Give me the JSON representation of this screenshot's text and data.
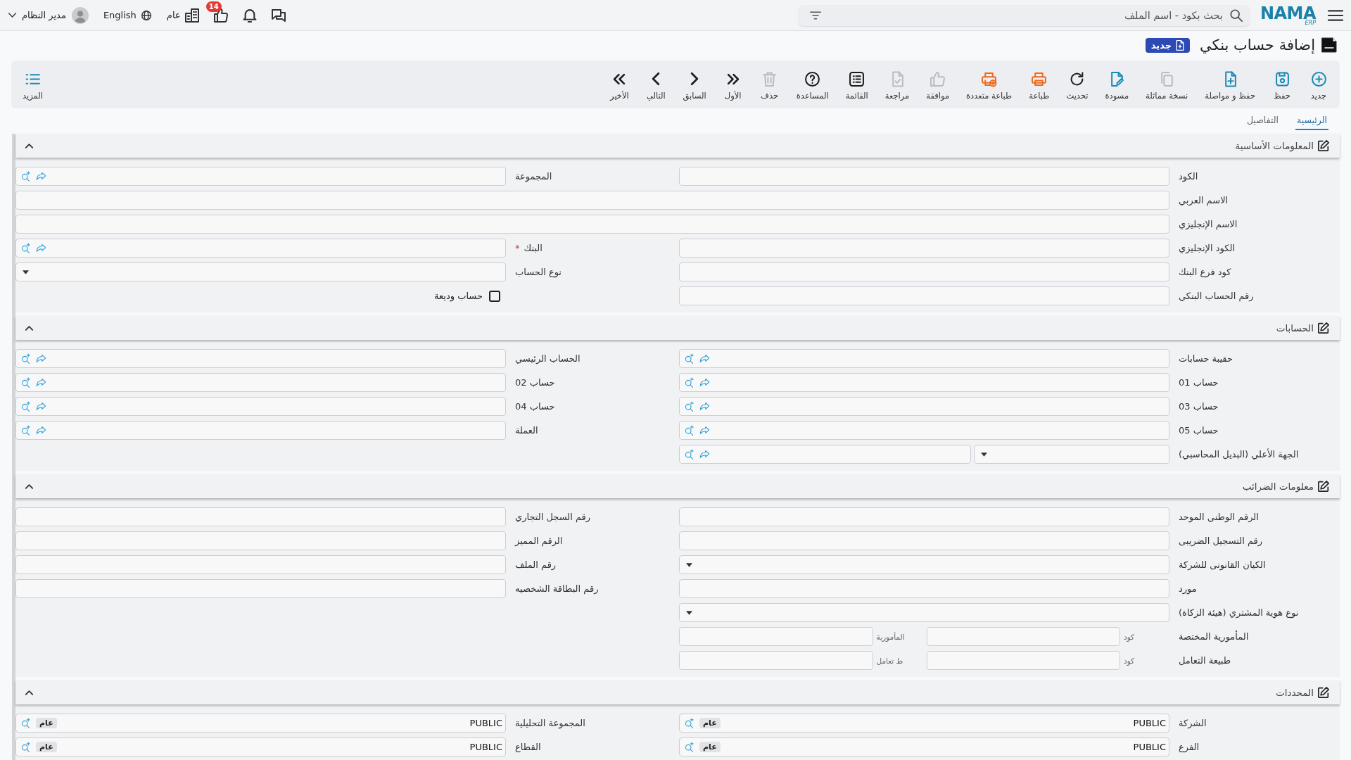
{
  "topbar": {
    "logo": {
      "brand": "NAMA",
      "suffix": "ERP"
    },
    "search": {
      "placeholder": "بحث بكود - اسم الملف"
    },
    "notifications": {
      "badge": "14"
    },
    "company": {
      "label": "عام"
    },
    "language": {
      "label": "English"
    },
    "user": {
      "name": "مدير النظام"
    }
  },
  "page": {
    "title": "إضافة حساب بنكي",
    "status_badge": "جديد"
  },
  "toolbar": {
    "buttons": [
      {
        "kind": "new",
        "label": "جديد",
        "disabled": false
      },
      {
        "kind": "save",
        "label": "حفظ",
        "disabled": false
      },
      {
        "kind": "savecontinue",
        "label": "حفظ و مواصلة",
        "disabled": false
      },
      {
        "kind": "duplicate",
        "label": "نسخة مماثلة",
        "disabled": true
      },
      {
        "kind": "draft",
        "label": "مسودة",
        "disabled": false
      },
      {
        "kind": "refresh",
        "label": "تحديث",
        "disabled": false
      },
      {
        "kind": "print",
        "label": "طباعة",
        "disabled": false
      },
      {
        "kind": "multiprint",
        "label": "طباعة متعددة",
        "disabled": false
      },
      {
        "kind": "approve",
        "label": "موافقة",
        "disabled": true
      },
      {
        "kind": "review",
        "label": "مراجعة",
        "disabled": true
      },
      {
        "kind": "list",
        "label": "القائمة",
        "disabled": false
      },
      {
        "kind": "help",
        "label": "المساعدة",
        "disabled": false
      },
      {
        "kind": "delete",
        "label": "حذف",
        "disabled": true
      },
      {
        "kind": "first",
        "label": "الأول",
        "disabled": false
      },
      {
        "kind": "previous",
        "label": "السابق",
        "disabled": false
      },
      {
        "kind": "next",
        "label": "التالي",
        "disabled": false
      },
      {
        "kind": "last",
        "label": "الأخير",
        "disabled": false
      }
    ],
    "more": {
      "label": "المزيد"
    }
  },
  "tabs": [
    {
      "label": "الرئيسية",
      "selected": true
    },
    {
      "label": "التفاصيل",
      "selected": false
    }
  ],
  "sections": [
    {
      "title": "المعلومات الأساسية",
      "expanded": true,
      "rows": [
        {
          "fields": [
            {
              "label": "الكود",
              "kind": "text"
            },
            {
              "label": "المجموعة",
              "kind": "lookup"
            }
          ]
        },
        {
          "fields": [
            {
              "label": "الاسم العربي",
              "kind": "text",
              "wide": true
            }
          ]
        },
        {
          "fields": [
            {
              "label": "الاسم الإنجليزي",
              "kind": "text",
              "wide": true
            }
          ]
        },
        {
          "fields": [
            {
              "label": "الكود الإنجليزي",
              "kind": "text"
            },
            {
              "label": "البنك",
              "kind": "lookup",
              "required_mark": "*"
            }
          ]
        },
        {
          "fields": [
            {
              "label": "كود فرع البنك",
              "kind": "text"
            },
            {
              "label": "نوع الحساب",
              "kind": "select"
            }
          ]
        },
        {
          "fields": [
            {
              "label": "رقم الحساب البنكي",
              "kind": "text"
            },
            {
              "label": "حساب وديعة",
              "kind": "checkbox",
              "checked": false
            }
          ]
        }
      ]
    },
    {
      "title": "الحسابات",
      "expanded": true,
      "rows": [
        {
          "fields": [
            {
              "label": "حقيبة حسابات",
              "kind": "lookup"
            },
            {
              "label": "الحساب الرئيسي",
              "kind": "lookup"
            }
          ]
        },
        {
          "fields": [
            {
              "label": "حساب 01",
              "kind": "lookup"
            },
            {
              "label": "حساب 02",
              "kind": "lookup"
            }
          ]
        },
        {
          "fields": [
            {
              "label": "حساب 03",
              "kind": "lookup"
            },
            {
              "label": "حساب 04",
              "kind": "lookup"
            }
          ]
        },
        {
          "fields": [
            {
              "label": "حساب 05",
              "kind": "lookup"
            },
            {
              "label": "العملة",
              "kind": "lookup"
            }
          ]
        },
        {
          "fields": [
            {
              "label": "الجهة الأعلي (البديل المحاسبي)",
              "kind": "select_lookup"
            }
          ]
        }
      ]
    },
    {
      "title": "معلومات الضرائب",
      "expanded": true,
      "rows": [
        {
          "fields": [
            {
              "label": "الرقم الوطني الموحد",
              "kind": "text"
            },
            {
              "label": "رقم السجل التجاري",
              "kind": "text"
            }
          ]
        },
        {
          "fields": [
            {
              "label": "رقم التسجيل الضريبى",
              "kind": "text"
            },
            {
              "label": "الرقم المميز",
              "kind": "text"
            }
          ]
        },
        {
          "fields": [
            {
              "label": "الكيان القانونى للشركة",
              "kind": "select"
            },
            {
              "label": "رقم الملف",
              "kind": "text"
            }
          ]
        },
        {
          "fields": [
            {
              "label": "مورد",
              "kind": "text"
            },
            {
              "label": "رقم البطاقة الشخصيه",
              "kind": "text"
            }
          ]
        },
        {
          "fields": [
            {
              "label": "نوع هوية المشتري (هيئة الزكاة)",
              "kind": "select"
            }
          ]
        },
        {
          "fields": [
            {
              "label": "المأمورية المختصة",
              "kind": "pair",
              "parts": [
                {
                  "label": "كود"
                },
                {
                  "label": "المأمورية"
                }
              ]
            }
          ]
        },
        {
          "fields": [
            {
              "label": "طبيعة التعامل",
              "kind": "pair",
              "parts": [
                {
                  "label": "كود"
                },
                {
                  "label": "ط تعامل"
                }
              ]
            }
          ]
        }
      ]
    },
    {
      "title": "المحددات",
      "expanded": true,
      "rows": [
        {
          "fields": [
            {
              "label": "الشركة",
              "kind": "dimension",
              "value": "PUBLIC",
              "tag": "عام"
            },
            {
              "label": "المجموعة التحليلية",
              "kind": "dimension",
              "value": "PUBLIC",
              "tag": "عام"
            }
          ]
        },
        {
          "fields": [
            {
              "label": "الفرع",
              "kind": "dimension",
              "value": "PUBLIC",
              "tag": "عام"
            },
            {
              "label": "القطاع",
              "kind": "dimension",
              "value": "PUBLIC",
              "tag": "عام"
            }
          ]
        }
      ]
    }
  ]
}
